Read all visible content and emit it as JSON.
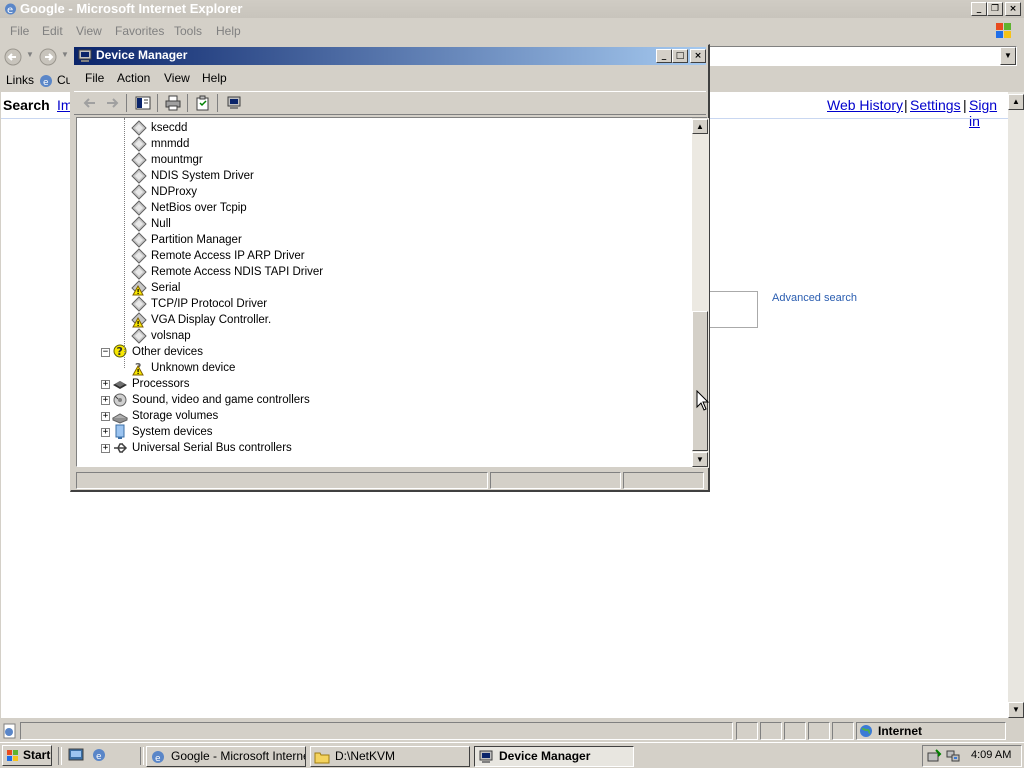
{
  "ie": {
    "title": "Google - Microsoft Internet Explorer",
    "menu": [
      "File",
      "Edit",
      "View",
      "Favorites",
      "Tools",
      "Help"
    ],
    "links_label": "Links",
    "links_item": "Cu",
    "google_search_label": "Search",
    "google_images_label": "Im",
    "google_top_links": [
      "Web History",
      "Settings",
      "Sign in"
    ],
    "google_sep": "|",
    "advanced_search": "Advanced search",
    "status_zone": "Internet"
  },
  "device_manager": {
    "title": "Device Manager",
    "menu": [
      "File",
      "Action",
      "View",
      "Help"
    ],
    "tree": [
      {
        "label": "ksecdd",
        "icon": "driver-icon",
        "level": 2
      },
      {
        "label": "mnmdd",
        "icon": "driver-icon",
        "level": 2
      },
      {
        "label": "mountmgr",
        "icon": "driver-icon",
        "level": 2
      },
      {
        "label": "NDIS System Driver",
        "icon": "driver-icon",
        "level": 2
      },
      {
        "label": "NDProxy",
        "icon": "driver-icon",
        "level": 2
      },
      {
        "label": "NetBios over Tcpip",
        "icon": "driver-icon",
        "level": 2
      },
      {
        "label": "Null",
        "icon": "driver-icon",
        "level": 2
      },
      {
        "label": "Partition Manager",
        "icon": "driver-icon",
        "level": 2
      },
      {
        "label": "Remote Access IP ARP Driver",
        "icon": "driver-icon",
        "level": 2
      },
      {
        "label": "Remote Access NDIS TAPI Driver",
        "icon": "driver-icon",
        "level": 2
      },
      {
        "label": "Serial",
        "icon": "driver-warning-icon",
        "level": 2
      },
      {
        "label": "TCP/IP Protocol Driver",
        "icon": "driver-icon",
        "level": 2
      },
      {
        "label": "VGA Display Controller.",
        "icon": "driver-warning-icon",
        "level": 2
      },
      {
        "label": "volsnap",
        "icon": "driver-icon",
        "level": 2
      },
      {
        "label": "Other devices",
        "icon": "unknown-device-category-icon",
        "level": 1,
        "expander": "minus"
      },
      {
        "label": "Unknown device",
        "icon": "unknown-device-warning-icon",
        "level": 2
      },
      {
        "label": "Processors",
        "icon": "processor-icon",
        "level": 1,
        "expander": "plus"
      },
      {
        "label": "Sound, video and game controllers",
        "icon": "sound-icon",
        "level": 1,
        "expander": "plus"
      },
      {
        "label": "Storage volumes",
        "icon": "storage-icon",
        "level": 1,
        "expander": "plus"
      },
      {
        "label": "System devices",
        "icon": "system-icon",
        "level": 1,
        "expander": "plus"
      },
      {
        "label": "Universal Serial Bus controllers",
        "icon": "usb-icon",
        "level": 1,
        "expander": "plus"
      }
    ]
  },
  "taskbar": {
    "start": "Start",
    "tasks": [
      "Google - Microsoft Interne...",
      "D:\\NetKVM",
      "Device Manager"
    ],
    "clock": "4:09 AM"
  }
}
